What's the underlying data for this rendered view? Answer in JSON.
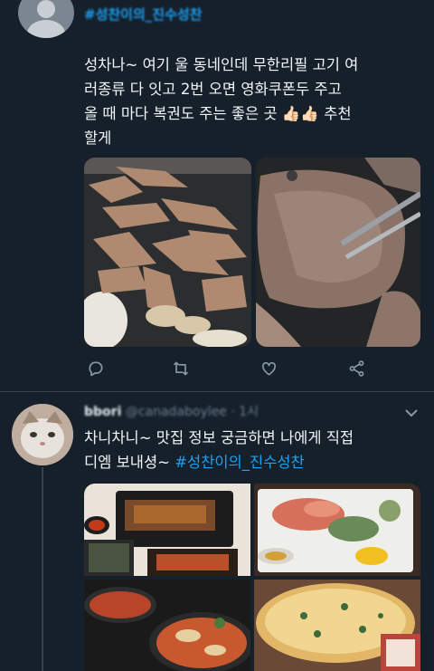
{
  "tweet1": {
    "header_hashtag": "#성찬이의_진수성찬",
    "text_lines": [
      "성차나~ 여기 울 동네인데 무한리필 고기 여",
      "러종류 다 잇고 2번 오면 영화쿠폰두 주고",
      "올 때 마다 복권도 주는 좋은 곳 👍🏻👍🏻 추천",
      "할게"
    ],
    "images": [
      "grilled-pork-slices",
      "grilled-beef-with-tongs"
    ],
    "actions": [
      "reply-icon",
      "retweet-icon",
      "like-icon",
      "share-icon"
    ]
  },
  "tweet2": {
    "display_name": "bbori",
    "handle_time": "@canadaboylee · 1시",
    "text_line1": "차니차니~ 맛집 정보 궁금하면 나에게 직접",
    "text_line2_prefix": "디엠 보내셩~ ",
    "text_hashtag": "#성찬이의_진수성찬",
    "images": [
      "korean-lunch-box",
      "sashimi-platter",
      "spicy-stew",
      "pizza"
    ]
  },
  "colors": {
    "background": "#15202b",
    "accent": "#1da1f2",
    "divider": "#38444d",
    "muted": "#6e7f8f"
  }
}
